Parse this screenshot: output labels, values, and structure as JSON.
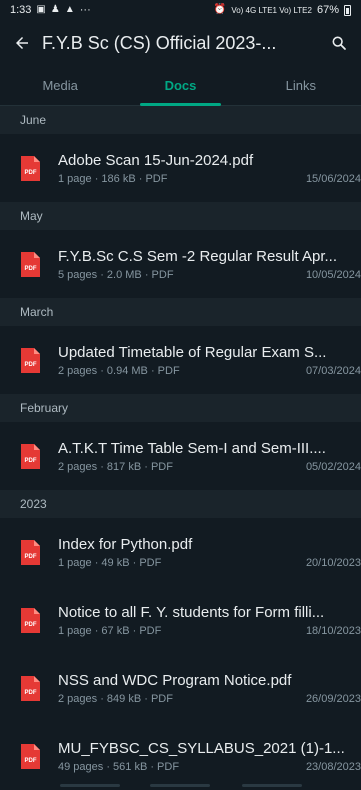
{
  "status_bar": {
    "time": "1:33",
    "left_icons": [
      "gallery-icon",
      "person-icon",
      "photo-icon"
    ],
    "more": "···",
    "network": "Vo) 4G LTE1  Vo) LTE2",
    "battery": "67%"
  },
  "app_bar": {
    "title": "F.Y.B Sc (CS) Official 2023-...",
    "back_icon": "arrow-left-icon",
    "search_icon": "search-icon"
  },
  "tabs": [
    {
      "label": "Media",
      "active": false
    },
    {
      "label": "Docs",
      "active": true
    },
    {
      "label": "Links",
      "active": false
    }
  ],
  "colors": {
    "accent": "#00a884",
    "pdf_red": "#e53935",
    "background": "#121b22"
  },
  "sections": [
    {
      "header": "June",
      "docs": [
        {
          "name": "Adobe Scan 15-Jun-2024.pdf",
          "meta": "1 page · 186 kB · PDF",
          "date": "15/06/2024"
        }
      ]
    },
    {
      "header": "May",
      "docs": [
        {
          "name": "F.Y.B.Sc C.S Sem -2 Regular Result Apr...",
          "meta": "5 pages · 2.0 MB · PDF",
          "date": "10/05/2024"
        }
      ]
    },
    {
      "header": "March",
      "docs": [
        {
          "name": "Updated Timetable of Regular Exam S...",
          "meta": "2 pages · 0.94 MB · PDF",
          "date": "07/03/2024"
        }
      ]
    },
    {
      "header": "February",
      "docs": [
        {
          "name": "A.T.K.T Time Table Sem-I and Sem-III....",
          "meta": "2 pages · 817 kB · PDF",
          "date": "05/02/2024"
        }
      ]
    },
    {
      "header": "2023",
      "docs": [
        {
          "name": "Index for Python.pdf",
          "meta": "1 page · 49 kB · PDF",
          "date": "20/10/2023"
        },
        {
          "name": "Notice to all F. Y. students for Form filli...",
          "meta": "1 page · 67 kB · PDF",
          "date": "18/10/2023"
        },
        {
          "name": "NSS and WDC Program Notice.pdf",
          "meta": "2 pages · 849 kB · PDF",
          "date": "26/09/2023"
        },
        {
          "name": "MU_FYBSC_CS_SYLLABUS_2021 (1)-1...",
          "meta": "49 pages · 561 kB · PDF",
          "date": "23/08/2023"
        }
      ]
    }
  ],
  "pdf_badge": "PDF"
}
